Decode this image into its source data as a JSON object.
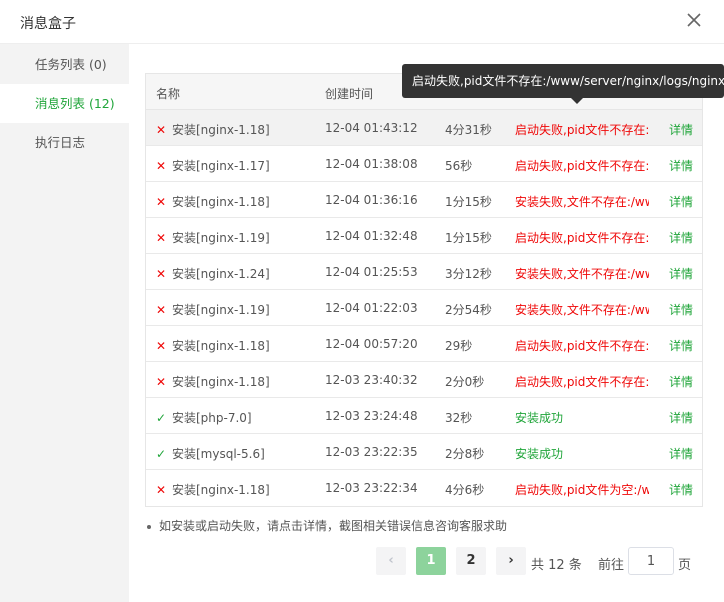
{
  "dialog": {
    "title": "消息盒子"
  },
  "sidebar": {
    "items": [
      {
        "label": "任务列表 (0)"
      },
      {
        "label": "消息列表 (12)"
      },
      {
        "label": "执行日志"
      }
    ]
  },
  "table": {
    "headers": {
      "name": "名称",
      "created": "创建时间"
    },
    "rows": [
      {
        "result": "fail",
        "name": "安装[nginx-1.18]",
        "time": "12-04 01:43:12",
        "duration": "4分31秒",
        "status": "启动失败,pid文件不存在:/www/server/nginx/logs/nginx.pid",
        "action": "详情"
      },
      {
        "result": "fail",
        "name": "安装[nginx-1.17]",
        "time": "12-04 01:38:08",
        "duration": "56秒",
        "status": "启动失败,pid文件不存在:/www/server/nginx/logs/nginx.pid",
        "action": "详情"
      },
      {
        "result": "fail",
        "name": "安装[nginx-1.18]",
        "time": "12-04 01:36:16",
        "duration": "1分15秒",
        "status": "安装失败,文件不存在:/www/server/nginx/sbin/nginx",
        "action": "详情"
      },
      {
        "result": "fail",
        "name": "安装[nginx-1.19]",
        "time": "12-04 01:32:48",
        "duration": "1分15秒",
        "status": "启动失败,pid文件不存在:/www/server/nginx/logs/nginx.pid",
        "action": "详情"
      },
      {
        "result": "fail",
        "name": "安装[nginx-1.24]",
        "time": "12-04 01:25:53",
        "duration": "3分12秒",
        "status": "安装失败,文件不存在:/www/server/nginx/sbin/nginx",
        "action": "详情"
      },
      {
        "result": "fail",
        "name": "安装[nginx-1.19]",
        "time": "12-04 01:22:03",
        "duration": "2分54秒",
        "status": "安装失败,文件不存在:/www/server/nginx/sbin/nginx",
        "action": "详情"
      },
      {
        "result": "fail",
        "name": "安装[nginx-1.18]",
        "time": "12-04 00:57:20",
        "duration": "29秒",
        "status": "启动失败,pid文件不存在:/www/server/nginx/logs/nginx.pid",
        "action": "详情"
      },
      {
        "result": "fail",
        "name": "安装[nginx-1.18]",
        "time": "12-03 23:40:32",
        "duration": "2分0秒",
        "status": "启动失败,pid文件不存在:/www/server/nginx/logs/nginx.pid",
        "action": "详情"
      },
      {
        "result": "ok",
        "name": "安装[php-7.0]",
        "time": "12-03 23:24:48",
        "duration": "32秒",
        "status": "安装成功",
        "action": "详情"
      },
      {
        "result": "ok",
        "name": "安装[mysql-5.6]",
        "time": "12-03 23:22:35",
        "duration": "2分8秒",
        "status": "安装成功",
        "action": "详情"
      },
      {
        "result": "fail",
        "name": "安装[nginx-1.18]",
        "time": "12-03 23:22:34",
        "duration": "4分6秒",
        "status": "启动失败,pid文件为空:/www/server/nginx/logs/nginx.pid",
        "action": "详情"
      }
    ]
  },
  "tooltip": {
    "text": "启动失败,pid文件不存在:/www/server/nginx/logs/nginx.pid"
  },
  "note": {
    "text": "如安装或启动失败，请点击详情，截图相关错误信息咨询客服求助"
  },
  "pagination": {
    "prev": "‹",
    "pages": [
      "1",
      "2"
    ],
    "next": "›",
    "total": "共 12 条",
    "goto_label": "前往",
    "goto_value": "1",
    "page_unit": "页"
  },
  "colors": {
    "accent": "#20a53a",
    "error": "#ef0808",
    "active_page": "#8dd39c"
  }
}
